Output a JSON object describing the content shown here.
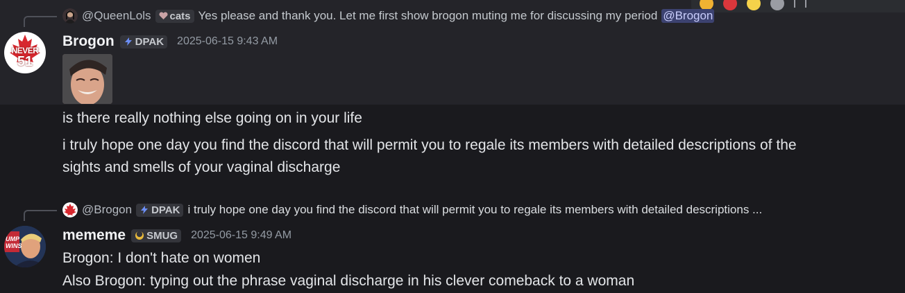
{
  "message1": {
    "reply": {
      "username": "@QueenLols",
      "tag": "cats",
      "text": "Yes please and thank you. Let me first show brogon muting me for discussing my period",
      "mention": "@Brogon"
    },
    "author": "Brogon",
    "tag": "DPAK",
    "timestamp": "2025-06-15 9:43 AM",
    "lines": [
      "is there really nothing else going on in your life",
      "i truly hope one day you find the discord that will permit you to regale its members with detailed descriptions of the",
      "sights and smells of your vaginal discharge"
    ]
  },
  "message2": {
    "reply": {
      "username": "@Brogon",
      "tag": "DPAK",
      "text": "i truly hope one day you find the discord that will permit you to regale its members with detailed descriptions ..."
    },
    "author": "mememe",
    "tag": "SMUG",
    "timestamp": "2025-06-15 9:49 AM",
    "lines": [
      "Brogon: I don't hate on women",
      "Also Brogon: typing out the phrase vaginal discharge in his clever comeback to a woman"
    ]
  },
  "avatar_text": {
    "brogon_top": "NEVER",
    "brogon_bottom": "51",
    "mememe": "UMP\nWINS"
  },
  "colors": {
    "background": "#1a1a1e",
    "highlight": "#242429",
    "mention_bg": "#3c4270",
    "mention_fg": "#c9cdfb",
    "avatar_red": "#d7282f"
  },
  "icons": {
    "dpak_tag": "lightning-icon",
    "cats_tag": "heart-icon",
    "smug_tag": "moon-icon"
  }
}
